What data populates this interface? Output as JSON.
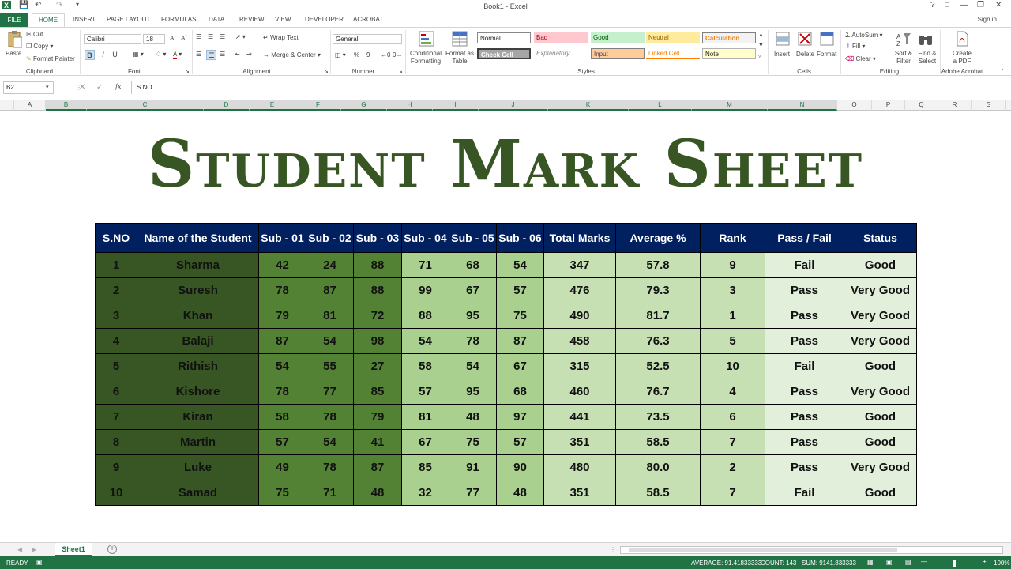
{
  "window": {
    "title": "Book1 - Excel"
  },
  "tabs": [
    "FILE",
    "HOME",
    "INSERT",
    "PAGE LAYOUT",
    "FORMULAS",
    "DATA",
    "REVIEW",
    "VIEW",
    "DEVELOPER",
    "ACROBAT"
  ],
  "sign_in": "Sign in",
  "ribbon": {
    "clipboard": {
      "paste": "Paste",
      "cut": "Cut",
      "copy": "Copy",
      "format_painter": "Format Painter",
      "label": "Clipboard"
    },
    "font": {
      "name": "Calibri",
      "size": "18",
      "label": "Font",
      "bold": "B",
      "italic": "I",
      "underline": "U"
    },
    "alignment": {
      "wrap": "Wrap Text",
      "merge": "Merge & Center",
      "label": "Alignment"
    },
    "number": {
      "format": "General",
      "percent": "%",
      "comma": "9",
      "label": "Number"
    },
    "styles": {
      "conditional": "Conditional Formatting",
      "format_table": "Format as Table",
      "cells": [
        "Normal",
        "Bad",
        "Good",
        "Neutral",
        "Calculation",
        "Check Cell",
        "Explanatory ...",
        "Input",
        "Linked Cell",
        "Note"
      ],
      "label": "Styles"
    },
    "cells": {
      "insert": "Insert",
      "delete": "Delete",
      "format": "Format",
      "label": "Cells"
    },
    "editing": {
      "autosum": "AutoSum",
      "fill": "Fill",
      "clear": "Clear",
      "sort": "Sort & Filter",
      "find": "Find & Select",
      "label": "Editing"
    },
    "acrobat": {
      "create": "Create a PDF",
      "label": "Adobe Acrobat"
    }
  },
  "formula_bar": {
    "name_box": "B2",
    "fx": "fx",
    "content": "S.NO"
  },
  "columns": [
    "A",
    "B",
    "C",
    "D",
    "E",
    "F",
    "G",
    "H",
    "I",
    "J",
    "K",
    "L",
    "M",
    "N",
    "O",
    "P",
    "Q",
    "R",
    "S"
  ],
  "sheet_title": "Student Mark Sheet",
  "table": {
    "headers": [
      "S.NO",
      "Name of the Student",
      "Sub - 01",
      "Sub - 02",
      "Sub - 03",
      "Sub - 04",
      "Sub - 05",
      "Sub - 06",
      "Total Marks",
      "Average %",
      "Rank",
      "Pass / Fail",
      "Status"
    ],
    "rows": [
      [
        "1",
        "Sharma",
        "42",
        "24",
        "88",
        "71",
        "68",
        "54",
        "347",
        "57.8",
        "9",
        "Fail",
        "Good"
      ],
      [
        "2",
        "Suresh",
        "78",
        "87",
        "88",
        "99",
        "67",
        "57",
        "476",
        "79.3",
        "3",
        "Pass",
        "Very Good"
      ],
      [
        "3",
        "Khan",
        "79",
        "81",
        "72",
        "88",
        "95",
        "75",
        "490",
        "81.7",
        "1",
        "Pass",
        "Very Good"
      ],
      [
        "4",
        "Balaji",
        "87",
        "54",
        "98",
        "54",
        "78",
        "87",
        "458",
        "76.3",
        "5",
        "Pass",
        "Very Good"
      ],
      [
        "5",
        "Rithish",
        "54",
        "55",
        "27",
        "58",
        "54",
        "67",
        "315",
        "52.5",
        "10",
        "Fail",
        "Good"
      ],
      [
        "6",
        "Kishore",
        "78",
        "77",
        "85",
        "57",
        "95",
        "68",
        "460",
        "76.7",
        "4",
        "Pass",
        "Very Good"
      ],
      [
        "7",
        "Kiran",
        "58",
        "78",
        "79",
        "81",
        "48",
        "97",
        "441",
        "73.5",
        "6",
        "Pass",
        "Good"
      ],
      [
        "8",
        "Martin",
        "57",
        "54",
        "41",
        "67",
        "75",
        "57",
        "351",
        "58.5",
        "7",
        "Pass",
        "Good"
      ],
      [
        "9",
        "Luke",
        "49",
        "78",
        "87",
        "85",
        "91",
        "90",
        "480",
        "80.0",
        "2",
        "Pass",
        "Very Good"
      ],
      [
        "10",
        "Samad",
        "75",
        "71",
        "48",
        "32",
        "77",
        "48",
        "351",
        "58.5",
        "7",
        "Fail",
        "Good"
      ]
    ]
  },
  "sheet_tabs": [
    "Sheet1"
  ],
  "status": {
    "ready": "READY",
    "average": "AVERAGE: 91.41833333",
    "count": "COUNT: 143",
    "sum": "SUM: 9141.833333",
    "zoom": "100%"
  },
  "colors": {
    "excel_green": "#217346",
    "header_navy": "#002060",
    "title_green": "#375623"
  }
}
